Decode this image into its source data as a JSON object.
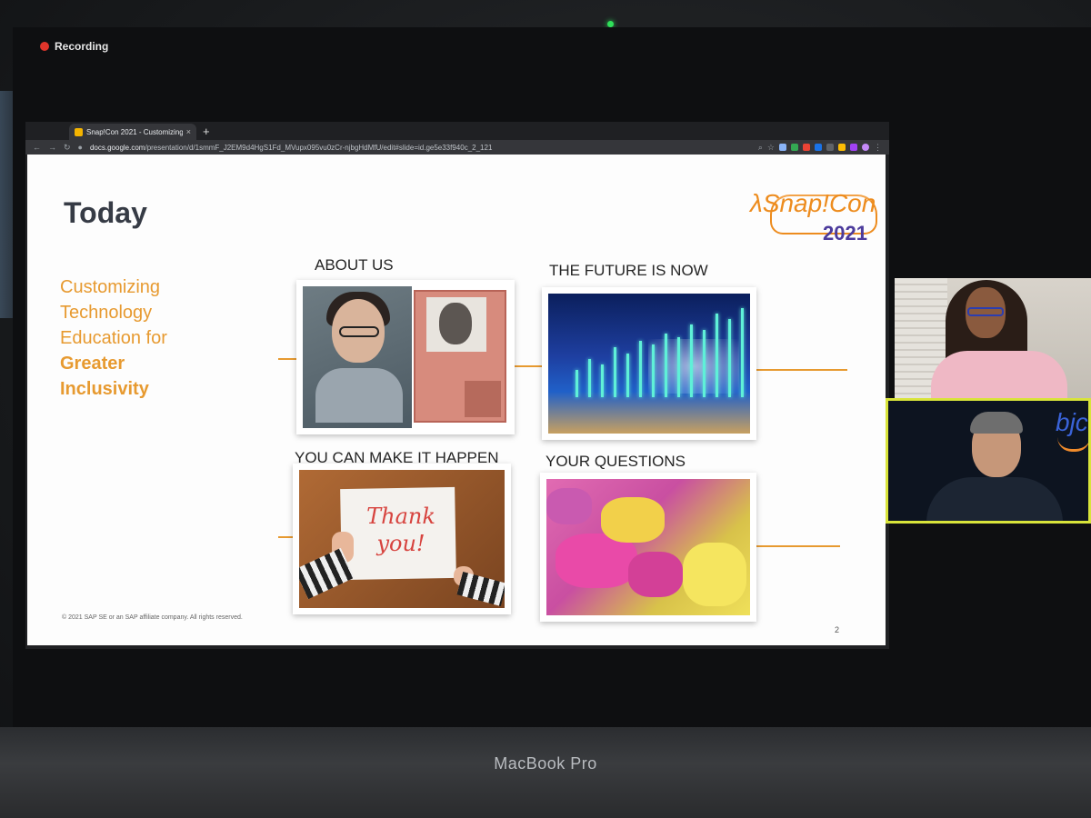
{
  "device": {
    "brand_label": "MacBook Pro"
  },
  "recording": {
    "label": "Recording"
  },
  "browser": {
    "tab_title": "Snap!Con 2021 - Customizing",
    "tab_close": "×",
    "new_tab": "+",
    "url_host": "docs.google.com",
    "url_path": "/presentation/d/1smmF_J2EM9d4HgS1Fd_MVupx095vu0zCr-njbgHdMfU/edit#slide=id.ge5e33f940c_2_121"
  },
  "slide": {
    "title": "Today",
    "logo_text": "λSnap!Con",
    "logo_year": "2021",
    "subtitle_lines": [
      "Customizing",
      "Technology",
      "Education for",
      "Greater",
      "Inclusivity"
    ],
    "quadrants": [
      {
        "label": "ABOUT US"
      },
      {
        "label": "THE FUTURE IS NOW"
      },
      {
        "label": "YOU CAN MAKE IT HAPPEN"
      },
      {
        "label": "YOUR QUESTIONS"
      }
    ],
    "thank_you_text": "Thank you!",
    "copyright": "© 2021 SAP SE or an SAP affiliate company. All rights reserved.",
    "page_number": "2"
  },
  "video_tiles": {
    "second_logo": "bjc"
  },
  "colors": {
    "accent_orange": "#e79a30",
    "title_dark": "#363b45",
    "recording_red": "#e0352b",
    "speaker_highlight": "#d8e43a"
  }
}
